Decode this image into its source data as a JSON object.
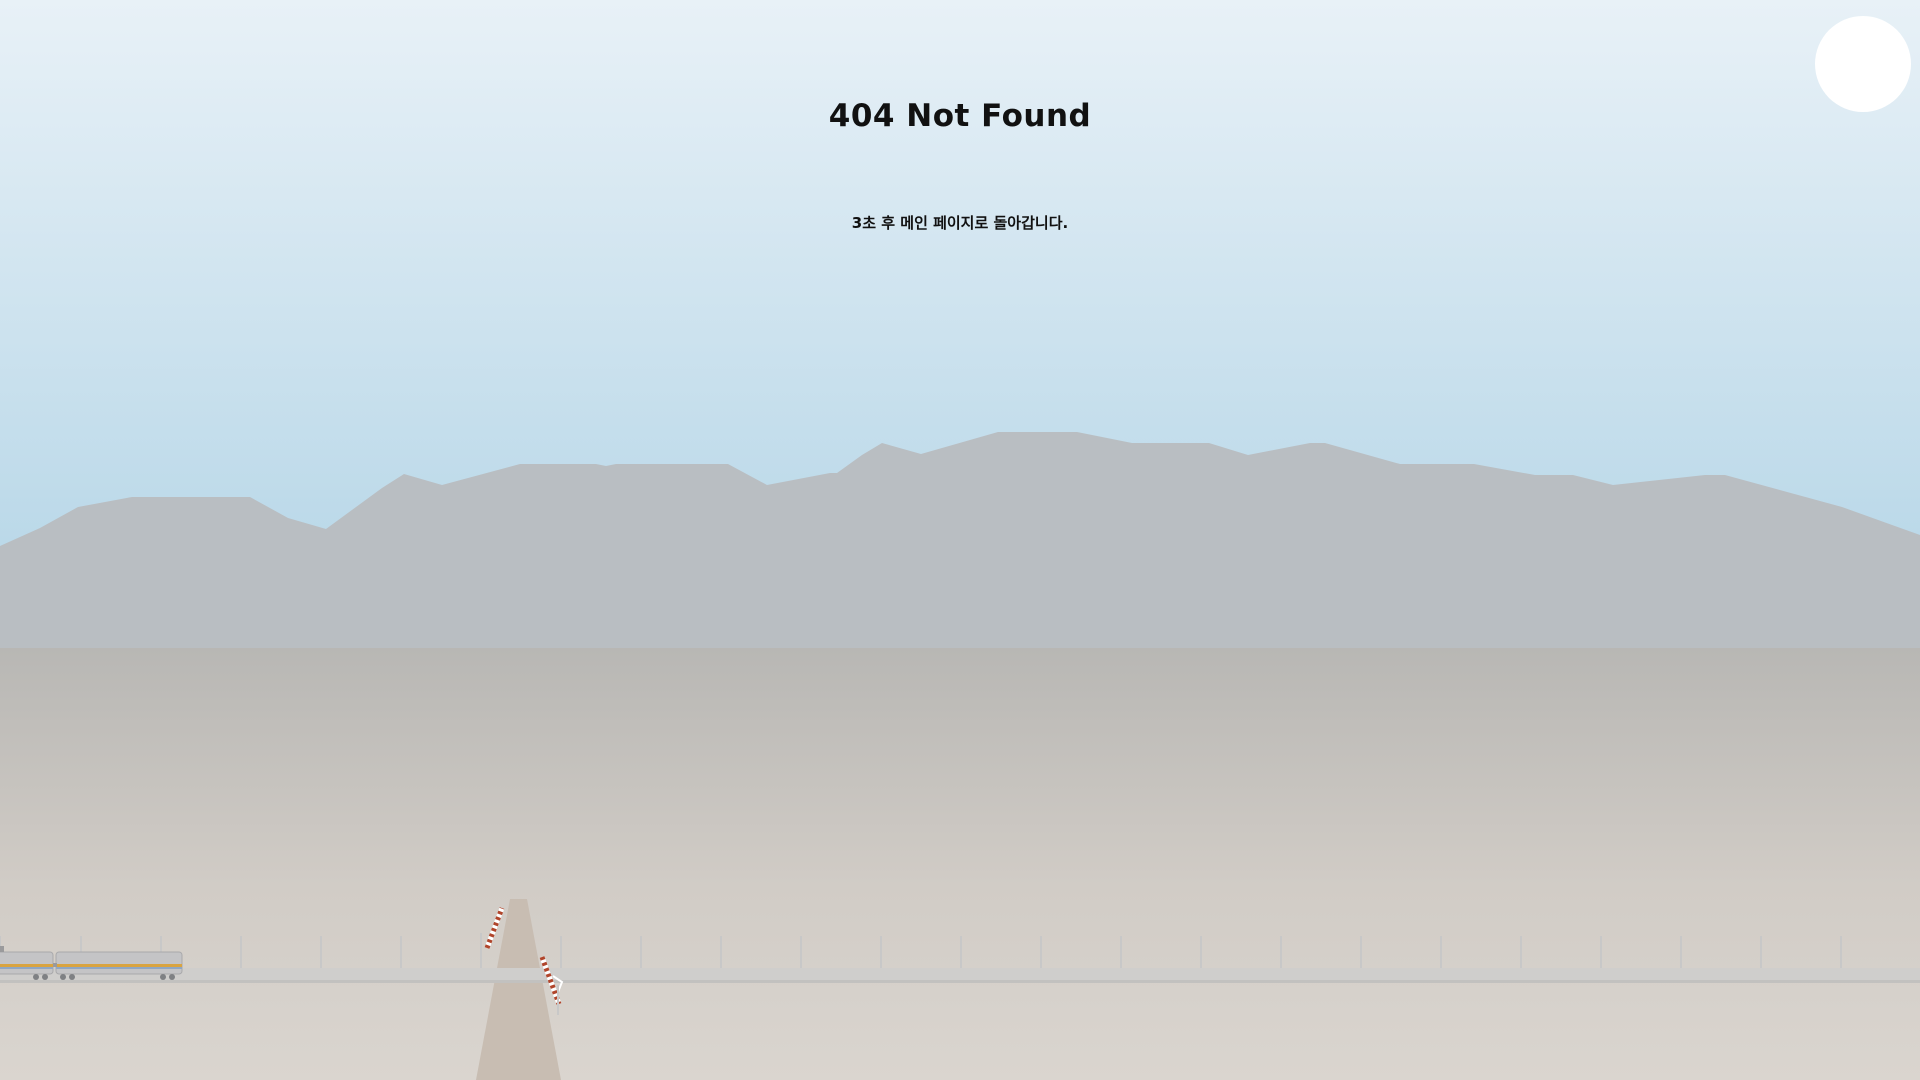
{
  "page": {
    "title": "404 Not Found",
    "message": "3초 후 메인 페이지로 돌아갑니다."
  },
  "colors": {
    "sky_top": "#e8f1f7",
    "sky_bottom": "#b2d4e6",
    "sun": "#ffffff",
    "mountains": "#b9bec2",
    "ground_top": "#b8b7b4",
    "ground_bottom": "#dad5cf",
    "rail": "#cfcecc",
    "pole": "#c8c8c8",
    "road": "#c8bdb2",
    "train_body": "#c4c4c6",
    "train_stripe": "#d9a441",
    "barrier_stripe": "#b0452b"
  },
  "icons": {
    "sun": "sun-icon",
    "train": "train-icon",
    "crossing_barrier": "crossing-barrier-icon"
  }
}
